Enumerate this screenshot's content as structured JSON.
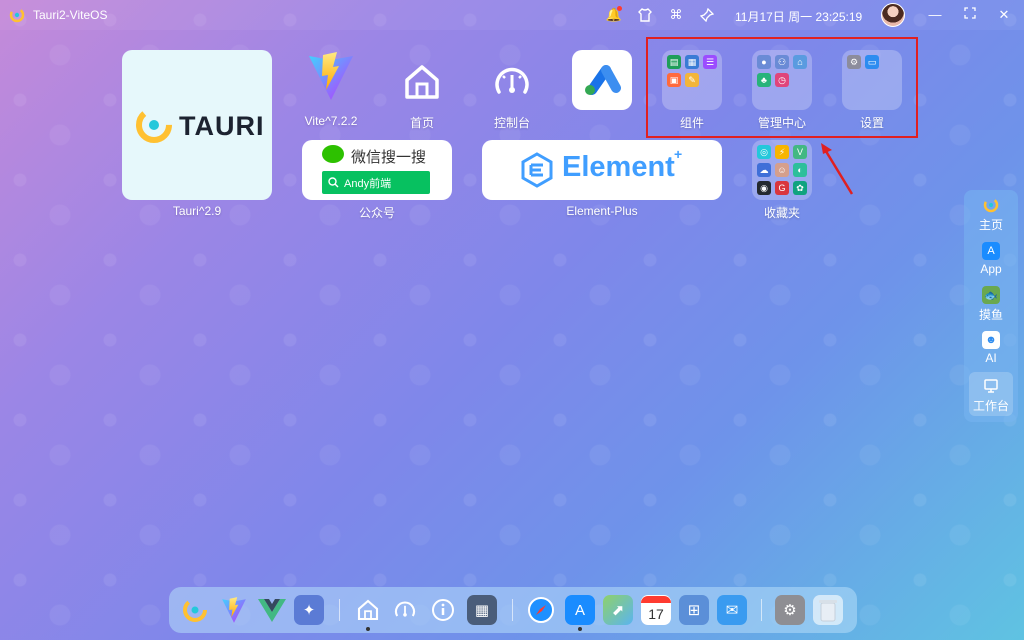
{
  "titlebar": {
    "app_title": "Tauri2-ViteOS",
    "clock": "11月17日 周一 23:25:19",
    "icons": [
      "bell-icon",
      "shirt-icon",
      "command-icon",
      "pin-icon"
    ],
    "window_buttons": [
      "minimize-icon",
      "fullscreen-icon",
      "close-icon"
    ]
  },
  "desktop": {
    "tauri": {
      "logo_text": "TAURI",
      "label": "Tauri^2.9"
    },
    "vite": {
      "label": "Vite^7.2.2"
    },
    "home": {
      "label": "首页"
    },
    "dashboard": {
      "label": "控制台"
    },
    "app_blue": {
      "label": ""
    },
    "wechat": {
      "title": "微信搜一搜",
      "search_text": "Andy前端",
      "label": "公众号"
    },
    "element": {
      "logo_text": "Element",
      "label": "Element-Plus"
    },
    "groups": {
      "components": {
        "label": "组件"
      },
      "admin": {
        "label": "管理中心"
      },
      "settings": {
        "label": "设置"
      },
      "favorites": {
        "label": "收藏夹"
      }
    }
  },
  "right_panel": {
    "items": [
      {
        "label": "主页",
        "icon": "tauri-icon"
      },
      {
        "label": "App",
        "icon": "appstore-icon"
      },
      {
        "label": "摸鱼",
        "icon": "fish-icon"
      },
      {
        "label": "AI",
        "icon": "robot-icon"
      },
      {
        "label": "工作台",
        "icon": "desktop-icon"
      }
    ]
  },
  "dock": {
    "items": [
      "tauri-icon",
      "vite-icon",
      "vue-icon",
      "launcher-icon",
      "home-icon",
      "dashboard-icon",
      "info-icon",
      "apps-group-icon",
      "safari-icon",
      "appstore-icon",
      "maps-icon",
      "calendar-icon",
      "app-grid-icon",
      "mail-icon",
      "settings-icon",
      "trash-icon"
    ],
    "calendar_day": "17",
    "colors": {
      "accent": "#e02020"
    }
  }
}
